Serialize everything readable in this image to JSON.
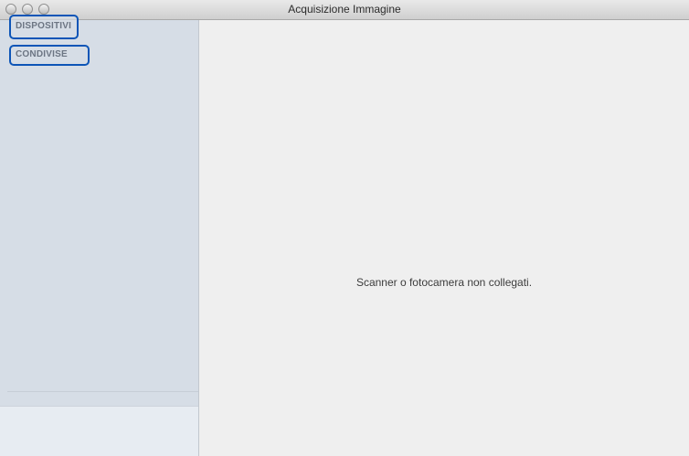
{
  "window": {
    "title": "Acquisizione Immagine"
  },
  "sidebar": {
    "sections": [
      {
        "label": "DISPOSITIVI"
      },
      {
        "label": "CONDIVISE"
      }
    ]
  },
  "main": {
    "status_text": "Scanner o fotocamera non collegati."
  }
}
